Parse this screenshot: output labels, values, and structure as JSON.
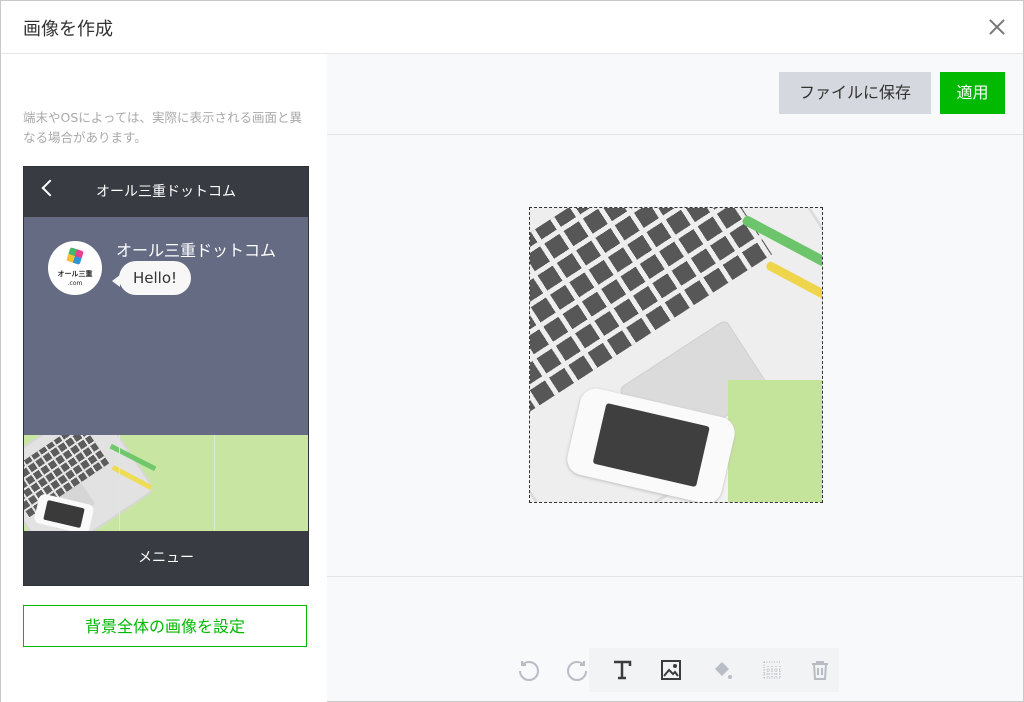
{
  "dialog": {
    "title": "画像を作成"
  },
  "left_panel": {
    "note": "端末やOSによっては、実際に表示される画面と異なる場合があります。",
    "preview": {
      "account_name": "オール三重ドットコム",
      "sender_name": "オール三重ドットコム",
      "message": "Hello!",
      "avatar_text_line1": "オール三重",
      "avatar_text_line2": ".com",
      "menu_label": "メニュー"
    },
    "set_background_button": "背景全体の画像を設定"
  },
  "right_panel": {
    "save_button": "ファイルに保存",
    "apply_button": "適用"
  },
  "toolbar": {
    "tools": [
      {
        "name": "undo-icon",
        "active": false
      },
      {
        "name": "redo-icon",
        "active": false
      },
      {
        "name": "text-icon",
        "active": true
      },
      {
        "name": "image-icon",
        "active": true
      },
      {
        "name": "fill-icon",
        "active": false
      },
      {
        "name": "grid-icon",
        "active": false
      },
      {
        "name": "trash-icon",
        "active": false
      }
    ]
  },
  "colors": {
    "accent": "#00b900",
    "header_dark": "#383b42",
    "chat_bg": "#646b83",
    "menu_preview": "#c9e5a2"
  }
}
